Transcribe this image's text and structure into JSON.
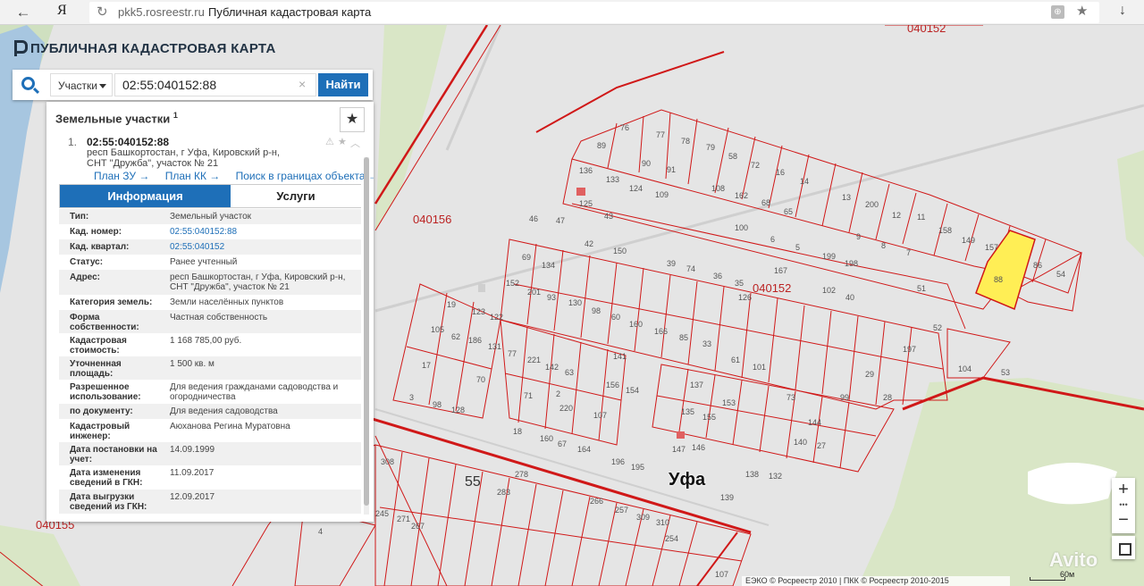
{
  "browser": {
    "back_glyph": "←",
    "ya_label": "Я",
    "refresh_glyph": "↻",
    "domain": "pkk5.rosreestr.ru",
    "page_title": "Публичная кадастровая карта",
    "star_glyph": "★",
    "download_glyph": "↓"
  },
  "site": {
    "title": "ПУБЛИЧНАЯ КАДАСТРОВАЯ КАРТА"
  },
  "search": {
    "type_label": "Участки",
    "query": "02:55:040152:88",
    "clear_glyph": "×",
    "find_label": "Найти"
  },
  "panel": {
    "title": "Земельные участки",
    "title_sup": "1",
    "fav_glyph": "★",
    "result": {
      "index": "1.",
      "cad_number": "02:55:040152:88",
      "address": "респ Башкортостан, г Уфа, Кировский р-н, СНТ \"Дружба\", участок № 21"
    },
    "links": [
      "План ЗУ →",
      "План КК →",
      "Поиск в границах объекта →"
    ],
    "tabs": {
      "info": "Информация",
      "services": "Услуги"
    },
    "rows": [
      {
        "k": "Тип:",
        "v": "Земельный участок"
      },
      {
        "k": "Кад. номер:",
        "v": "02:55:040152:88",
        "link": true
      },
      {
        "k": "Кад. квартал:",
        "v": "02:55:040152",
        "link": true
      },
      {
        "k": "Статус:",
        "v": "Ранее учтенный"
      },
      {
        "k": "Адрес:",
        "v": "респ Башкортостан, г Уфа, Кировский р-н, СНТ \"Дружба\", участок № 21"
      },
      {
        "k": "Категория земель:",
        "v": "Земли населённых пунктов"
      },
      {
        "k": "Форма собственности:",
        "v": "Частная собственность"
      },
      {
        "k": "Кадастровая стоимость:",
        "v": "1 168 785,00 руб."
      },
      {
        "k": "Уточненная площадь:",
        "v": "1 500 кв. м"
      },
      {
        "k": "Разрешенное использование:",
        "v": "Для ведения гражданами садоводства и огородничества"
      },
      {
        "k": "по документу:",
        "v": "Для ведения садоводства"
      },
      {
        "k": "Кадастровый инженер:",
        "v": "Аюханова Регина Муратовна"
      },
      {
        "k": "Дата постановки на учет:",
        "v": "14.09.1999"
      },
      {
        "k": "Дата изменения сведений в ГКН:",
        "v": "11.09.2017"
      },
      {
        "k": "Дата выгрузки сведений из ГКН:",
        "v": "12.09.2017"
      }
    ]
  },
  "map": {
    "quarter_labels": [
      "040152",
      "040156",
      "040152",
      "040155"
    ],
    "city": "Уфа",
    "block_55": "55",
    "plot_numbers": [
      "76",
      "77",
      "78",
      "79",
      "58",
      "72",
      "16",
      "14",
      "89",
      "90",
      "91",
      "136",
      "133",
      "124",
      "109",
      "108",
      "162",
      "68",
      "65",
      "125",
      "43",
      "100",
      "6",
      "5",
      "167",
      "199",
      "198",
      "102",
      "40",
      "42",
      "150",
      "39",
      "74",
      "36",
      "35",
      "47",
      "46",
      "69",
      "134",
      "152",
      "201",
      "93",
      "130",
      "98",
      "60",
      "160",
      "166",
      "85",
      "33",
      "61",
      "101",
      "19",
      "123",
      "122",
      "105",
      "62",
      "186",
      "131",
      "77",
      "221",
      "142",
      "63",
      "141",
      "17",
      "70",
      "128",
      "156",
      "154",
      "3",
      "98",
      "71",
      "2",
      "220",
      "107",
      "18",
      "160",
      "67",
      "164",
      "196",
      "195",
      "137",
      "135",
      "155",
      "153",
      "147",
      "146",
      "139",
      "138",
      "99",
      "144",
      "140",
      "27",
      "88",
      "86",
      "54",
      "157",
      "149",
      "158",
      "104",
      "53",
      "11",
      "12",
      "200",
      "13",
      "9",
      "8",
      "7",
      "51",
      "52",
      "197",
      "29",
      "28",
      "132",
      "126",
      "73",
      "308",
      "278",
      "283",
      "266",
      "257",
      "309",
      "310",
      "254",
      "107",
      "4",
      "245",
      "271",
      "267"
    ],
    "scale_text": "60м",
    "copyright": "ЕЭКО © Росреестр 2010 | ПКК © Росреестр 2010-2015",
    "watermark": "Avito"
  },
  "colors": {
    "accent": "#1e6fb8",
    "parcel_line": "#d01818",
    "selected_parcel": "#ffee55",
    "greenery": "#d9e6c6",
    "water": "#a7c6e0"
  }
}
